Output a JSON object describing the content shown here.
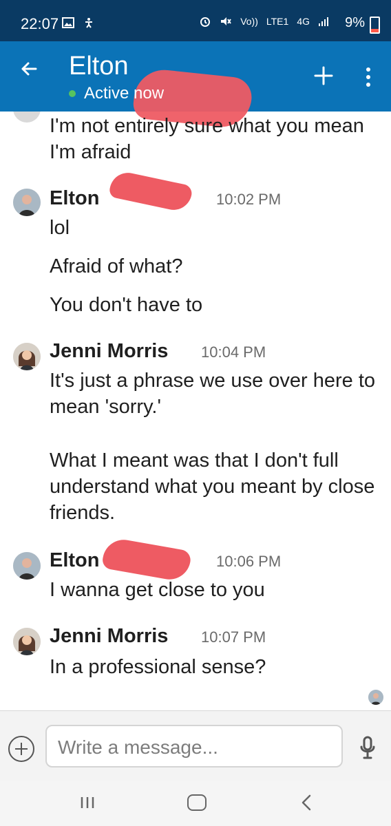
{
  "status_bar": {
    "time": "22:07",
    "battery": "9%",
    "network_labels": [
      "Vo))",
      "LTE1",
      "4G"
    ]
  },
  "header": {
    "title": "Elton",
    "status": "Active now"
  },
  "messages": [
    {
      "text": "I'm not entirely sure what you mean I'm afraid"
    },
    {
      "sender": "Elton",
      "time": "10:02 PM",
      "texts": [
        "lol",
        "Afraid of what?",
        "You don't have to"
      ]
    },
    {
      "sender": "Jenni Morris",
      "time": "10:04 PM",
      "texts": [
        "It's just a phrase we use over here to mean 'sorry.'",
        "What I meant was that I don't full understand what you meant by close friends."
      ]
    },
    {
      "sender": "Elton",
      "time": "10:06 PM",
      "texts": [
        "I wanna get close to you"
      ]
    },
    {
      "sender": "Jenni Morris",
      "time": "10:07 PM",
      "texts": [
        "In a professional sense?"
      ]
    }
  ],
  "composer": {
    "placeholder": "Write a message..."
  },
  "icons": {
    "back": "arrow-left-icon",
    "plus": "plus-icon",
    "more": "more-vertical-icon",
    "attach": "plus-circle-icon",
    "mic": "microphone-icon",
    "nav_recent": "recents-icon",
    "nav_home": "home-icon",
    "nav_back": "back-icon"
  },
  "colors": {
    "status_bar": "#0a3a63",
    "app_bar": "#0b73b7",
    "active_dot": "#57c35f",
    "redaction": "#ee5b63"
  }
}
